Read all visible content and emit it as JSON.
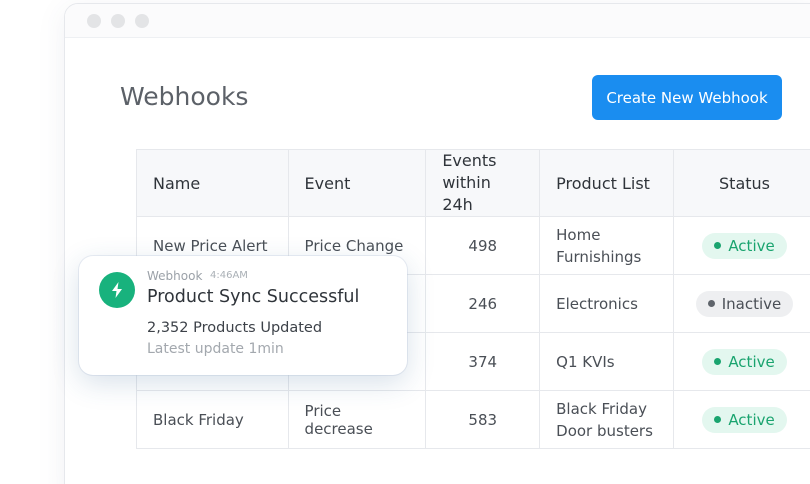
{
  "page": {
    "title": "Webhooks",
    "create_button": "Create New Webhook"
  },
  "table": {
    "headers": {
      "name": "Name",
      "event": "Event",
      "count_line1": "Events",
      "count_line2": "within 24h",
      "list": "Product List",
      "status": "Status"
    },
    "rows": [
      {
        "name": "New Price Alert",
        "event": "Price Change",
        "count": "498",
        "list_line1": "Home",
        "list_line2": "Furnishings",
        "status": "Active"
      },
      {
        "name": "",
        "event": "",
        "count": "246",
        "list_line1": "Electronics",
        "list_line2": "",
        "status": "Inactive"
      },
      {
        "name": "",
        "event": "",
        "count": "374",
        "list_line1": "Q1 KVIs",
        "list_line2": "",
        "status": "Active"
      },
      {
        "name": "Black Friday",
        "event": "Price decrease",
        "count": "583",
        "list_line1": "Black Friday",
        "list_line2": "Door busters",
        "status": "Active"
      }
    ]
  },
  "toast": {
    "source": "Webhook",
    "time": "4:46AM",
    "title": "Product Sync Successful",
    "line1": "2,352 Products Updated",
    "line2": "Latest update 1min",
    "icon": "lightning-bolt-icon"
  },
  "colors": {
    "accent": "#1a8df0",
    "active": "#1aa46f",
    "toast_icon": "#18b27d"
  }
}
